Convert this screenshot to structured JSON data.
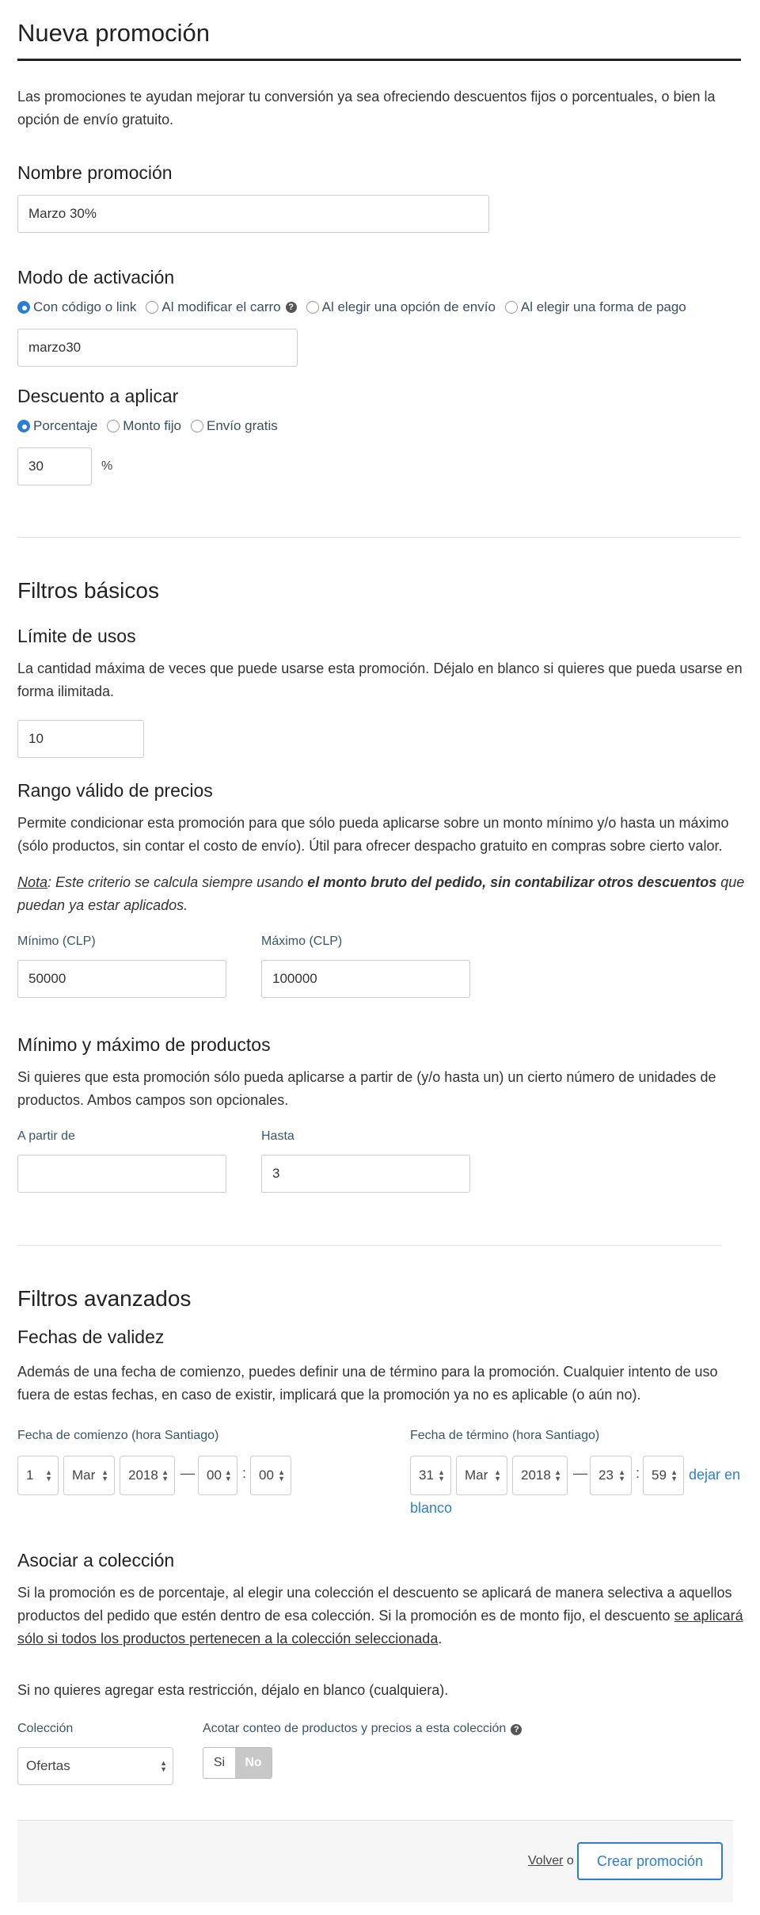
{
  "header": {
    "title": "Nueva promoción"
  },
  "intro": "Las promociones te ayudan mejorar tu conversión ya sea ofreciendo descuentos fijos o porcentuales, o bien la",
  "intro_line2": "opción de envío gratuito.",
  "name_section": {
    "label": "Nombre promoción",
    "value": "Marzo 30%"
  },
  "activation": {
    "label": "Modo de activación",
    "options": [
      "Con código o link",
      "Al modificar el carro",
      "Al elegir una opción de envío",
      "Al elegir una forma de pago"
    ],
    "selected_index": 0,
    "code_value": "marzo30"
  },
  "discount": {
    "label": "Descuento a aplicar",
    "options": [
      "Porcentaje",
      "Monto fijo",
      "Envío gratis"
    ],
    "selected_index": 0,
    "value": "30",
    "unit": "%"
  },
  "basic_filters": {
    "title": "Filtros básicos",
    "usage_limit": {
      "title": "Límite de usos",
      "desc1": "La cantidad máxima de veces que puede usarse esta promoción. Déjalo en blanco si quieres que pueda usarse en",
      "desc2": "forma ilimitada.",
      "value": "10"
    },
    "price_range": {
      "title": "Rango válido de precios",
      "desc1": "Permite condicionar esta promoción para que sólo pueda aplicarse sobre un monto mínimo y/o hasta un máximo",
      "desc2": "(sólo productos, sin contar el costo de envío). Útil para ofrecer despacho gratuito en compras sobre cierto valor.",
      "note_label": "Nota",
      "note_text1": ": Este criterio se calcula siempre usando ",
      "note_bold": "el monto bruto del pedido, sin contabilizar otros descuentos",
      "note_text2": " que",
      "note_line2": "puedan ya estar aplicados.",
      "min_label": "Mínimo (CLP)",
      "min_value": "50000",
      "max_label": "Máximo (CLP)",
      "max_value": "100000"
    },
    "product_count": {
      "title": "Mínimo y máximo de productos",
      "desc1": "Si quieres que esta promoción sólo pueda aplicarse a partir de (y/o hasta un) un cierto número de unidades de",
      "desc2": "productos. Ambos campos son opcionales.",
      "from_label": "A partir de",
      "from_value": "",
      "to_label": "Hasta",
      "to_value": "3"
    }
  },
  "advanced_filters": {
    "title": "Filtros avanzados",
    "dates": {
      "title": "Fechas de validez",
      "desc1": "Además de una fecha de comienzo, puedes definir una de término para la promoción. Cualquier intento de uso",
      "desc2": "fuera de estas fechas, en caso de existir, implicará que la promoción ya no es aplicable (o aún no).",
      "start_label": "Fecha de comienzo (hora Santiago)",
      "start": {
        "day": "1",
        "month": "Mar",
        "year": "2018",
        "hour": "00",
        "minute": "00"
      },
      "end_label": "Fecha de término (hora Santiago)",
      "end": {
        "day": "31",
        "month": "Mar",
        "year": "2018",
        "hour": "23",
        "minute": "59"
      },
      "dash": "—",
      "colon": ":",
      "leave_blank_1": "dejar en",
      "leave_blank_2": "blanco"
    },
    "collection": {
      "title": "Asociar a colección",
      "desc1": "Si la promoción es de porcentaje, al elegir una colección el descuento se aplicará de manera selectiva a aquellos",
      "desc2a": "productos del pedido que estén dentro de esa colección. Si la promoción es de monto fijo, el descuento ",
      "desc2b": "se aplicará",
      "desc3a": "sólo si todos los productos pertenecen a la colección seleccionada",
      "desc3b": ".",
      "blank_hint": "Si no quieres agregar esta restricción, déjalo en blanco (cualquiera).",
      "select_label": "Colección",
      "select_value": "Ofertas",
      "restrict_label": "Acotar conteo de productos y precios a esta colección",
      "toggle_yes": "Si",
      "toggle_no": "No"
    }
  },
  "footer": {
    "back_label": "Volver",
    "or": "o",
    "create_label": "Crear promoción"
  },
  "colors": {
    "accent": "#2b7fd3",
    "toggle_active": "#c8c8c8"
  }
}
